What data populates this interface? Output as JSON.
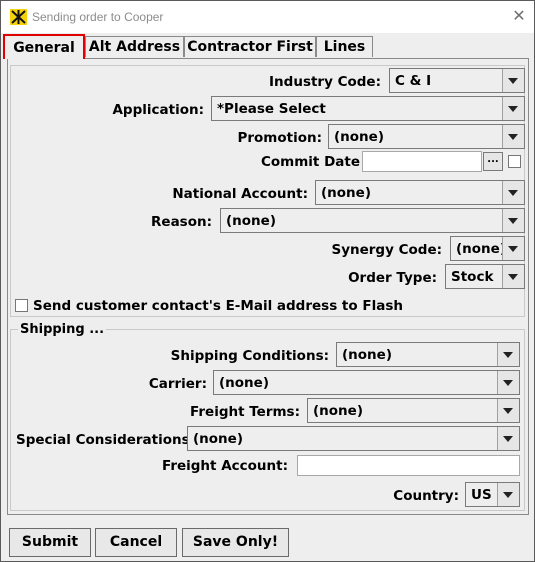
{
  "window": {
    "title": "Sending order to Cooper",
    "close_glyph": "✕",
    "app_icon": "app-logo-icon"
  },
  "tabs": [
    {
      "label": "General",
      "active": true
    },
    {
      "label": "Alt Address"
    },
    {
      "label": "Contractor First"
    },
    {
      "label": "Lines"
    }
  ],
  "general": {
    "industry_code": {
      "label": "Industry Code:",
      "value": "C & I"
    },
    "application": {
      "label": "Application:",
      "value": "*Please Select"
    },
    "promotion": {
      "label": "Promotion:",
      "value": "(none)"
    },
    "commit_date": {
      "label": "Commit Date",
      "value": "",
      "picker_label": "..."
    },
    "national_account": {
      "label": "National Account:",
      "value": "(none)"
    },
    "reason": {
      "label": "Reason:",
      "value": "(none)"
    },
    "synergy_code": {
      "label": "Synergy Code:",
      "value": "(none)"
    },
    "order_type": {
      "label": "Order Type:",
      "value": "Stock"
    },
    "send_email": {
      "label": "Send customer contact's E-Mail address to Flash",
      "checked": false
    }
  },
  "shipping": {
    "title": "Shipping ...",
    "shipping_conditions": {
      "label": "Shipping Conditions:",
      "value": "(none)"
    },
    "carrier": {
      "label": "Carrier:",
      "value": "(none)"
    },
    "freight_terms": {
      "label": "Freight Terms:",
      "value": "(none)"
    },
    "special_considerations": {
      "label": "Special Considerations:",
      "value": "(none)"
    },
    "freight_account": {
      "label": "Freight Account:",
      "value": ""
    },
    "country": {
      "label": "Country:",
      "value": "US"
    }
  },
  "buttons": {
    "submit": "Submit",
    "cancel": "Cancel",
    "save_only": "Save Only!"
  },
  "colors": {
    "active_tab_outline": "#e00000",
    "window_bg": "#eeeeee"
  }
}
